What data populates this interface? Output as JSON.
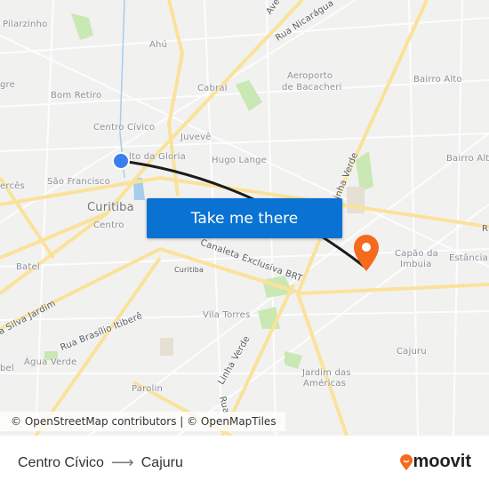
{
  "map": {
    "labels": {
      "pilarzinho": "Pilarzinho",
      "ahu": "Ahú",
      "av": "Ave",
      "nicaragua": "Rua Nicarágua",
      "aeroporto1": "Aeroporto",
      "aeroporto2": "de Bacacheri",
      "bairro_alto": "Bairro Alto",
      "gre": "gre",
      "bom_retiro": "Bom Retiro",
      "cabral": "Cabral",
      "centro_civico": "Centro Cívico",
      "juveve": "Juvevê",
      "alto_gloria": "lto da Gloria",
      "hugo_lange": "Hugo Lange",
      "bairro_alto2": "Bairro Alt",
      "merces": "ercês",
      "sao_francisco": "São Francisco",
      "linha_verde": "Linha Verde",
      "curitiba": "Curitiba",
      "centro": "Centro",
      "canaleta": "Canaleta Exclusiva BRT",
      "curitiba_small": "Curitiba",
      "capao1": "Capão da",
      "capao2": "Imbuia",
      "estancia": "Estância",
      "r": "R",
      "batel": "Batel",
      "silva_jardim": "a Silva Jardim",
      "brasilio": "Rua Brasílio Itiberê",
      "vila_torres": "Vila Torres",
      "linha_verde2": "Linha Verde",
      "agua_verde": "Água Verde",
      "jardim1": "Jardim das",
      "jardim2": "Américas",
      "cajuru": "Cajuru",
      "parolin": "Parolin",
      "bel": "bel",
      "rua": "Rua"
    },
    "origin_color": "#3d7ff0",
    "destination_color": "#f56a1c",
    "route_color": "#1b1b1b",
    "cta_label": "Take me there",
    "attribution": "© OpenStreetMap contributors | © OpenMapTiles"
  },
  "footer": {
    "origin": "Centro Cívico",
    "arrow": "⟶",
    "destination": "Cajuru",
    "brand": "moovit",
    "brand_color": "#f56a1c"
  }
}
